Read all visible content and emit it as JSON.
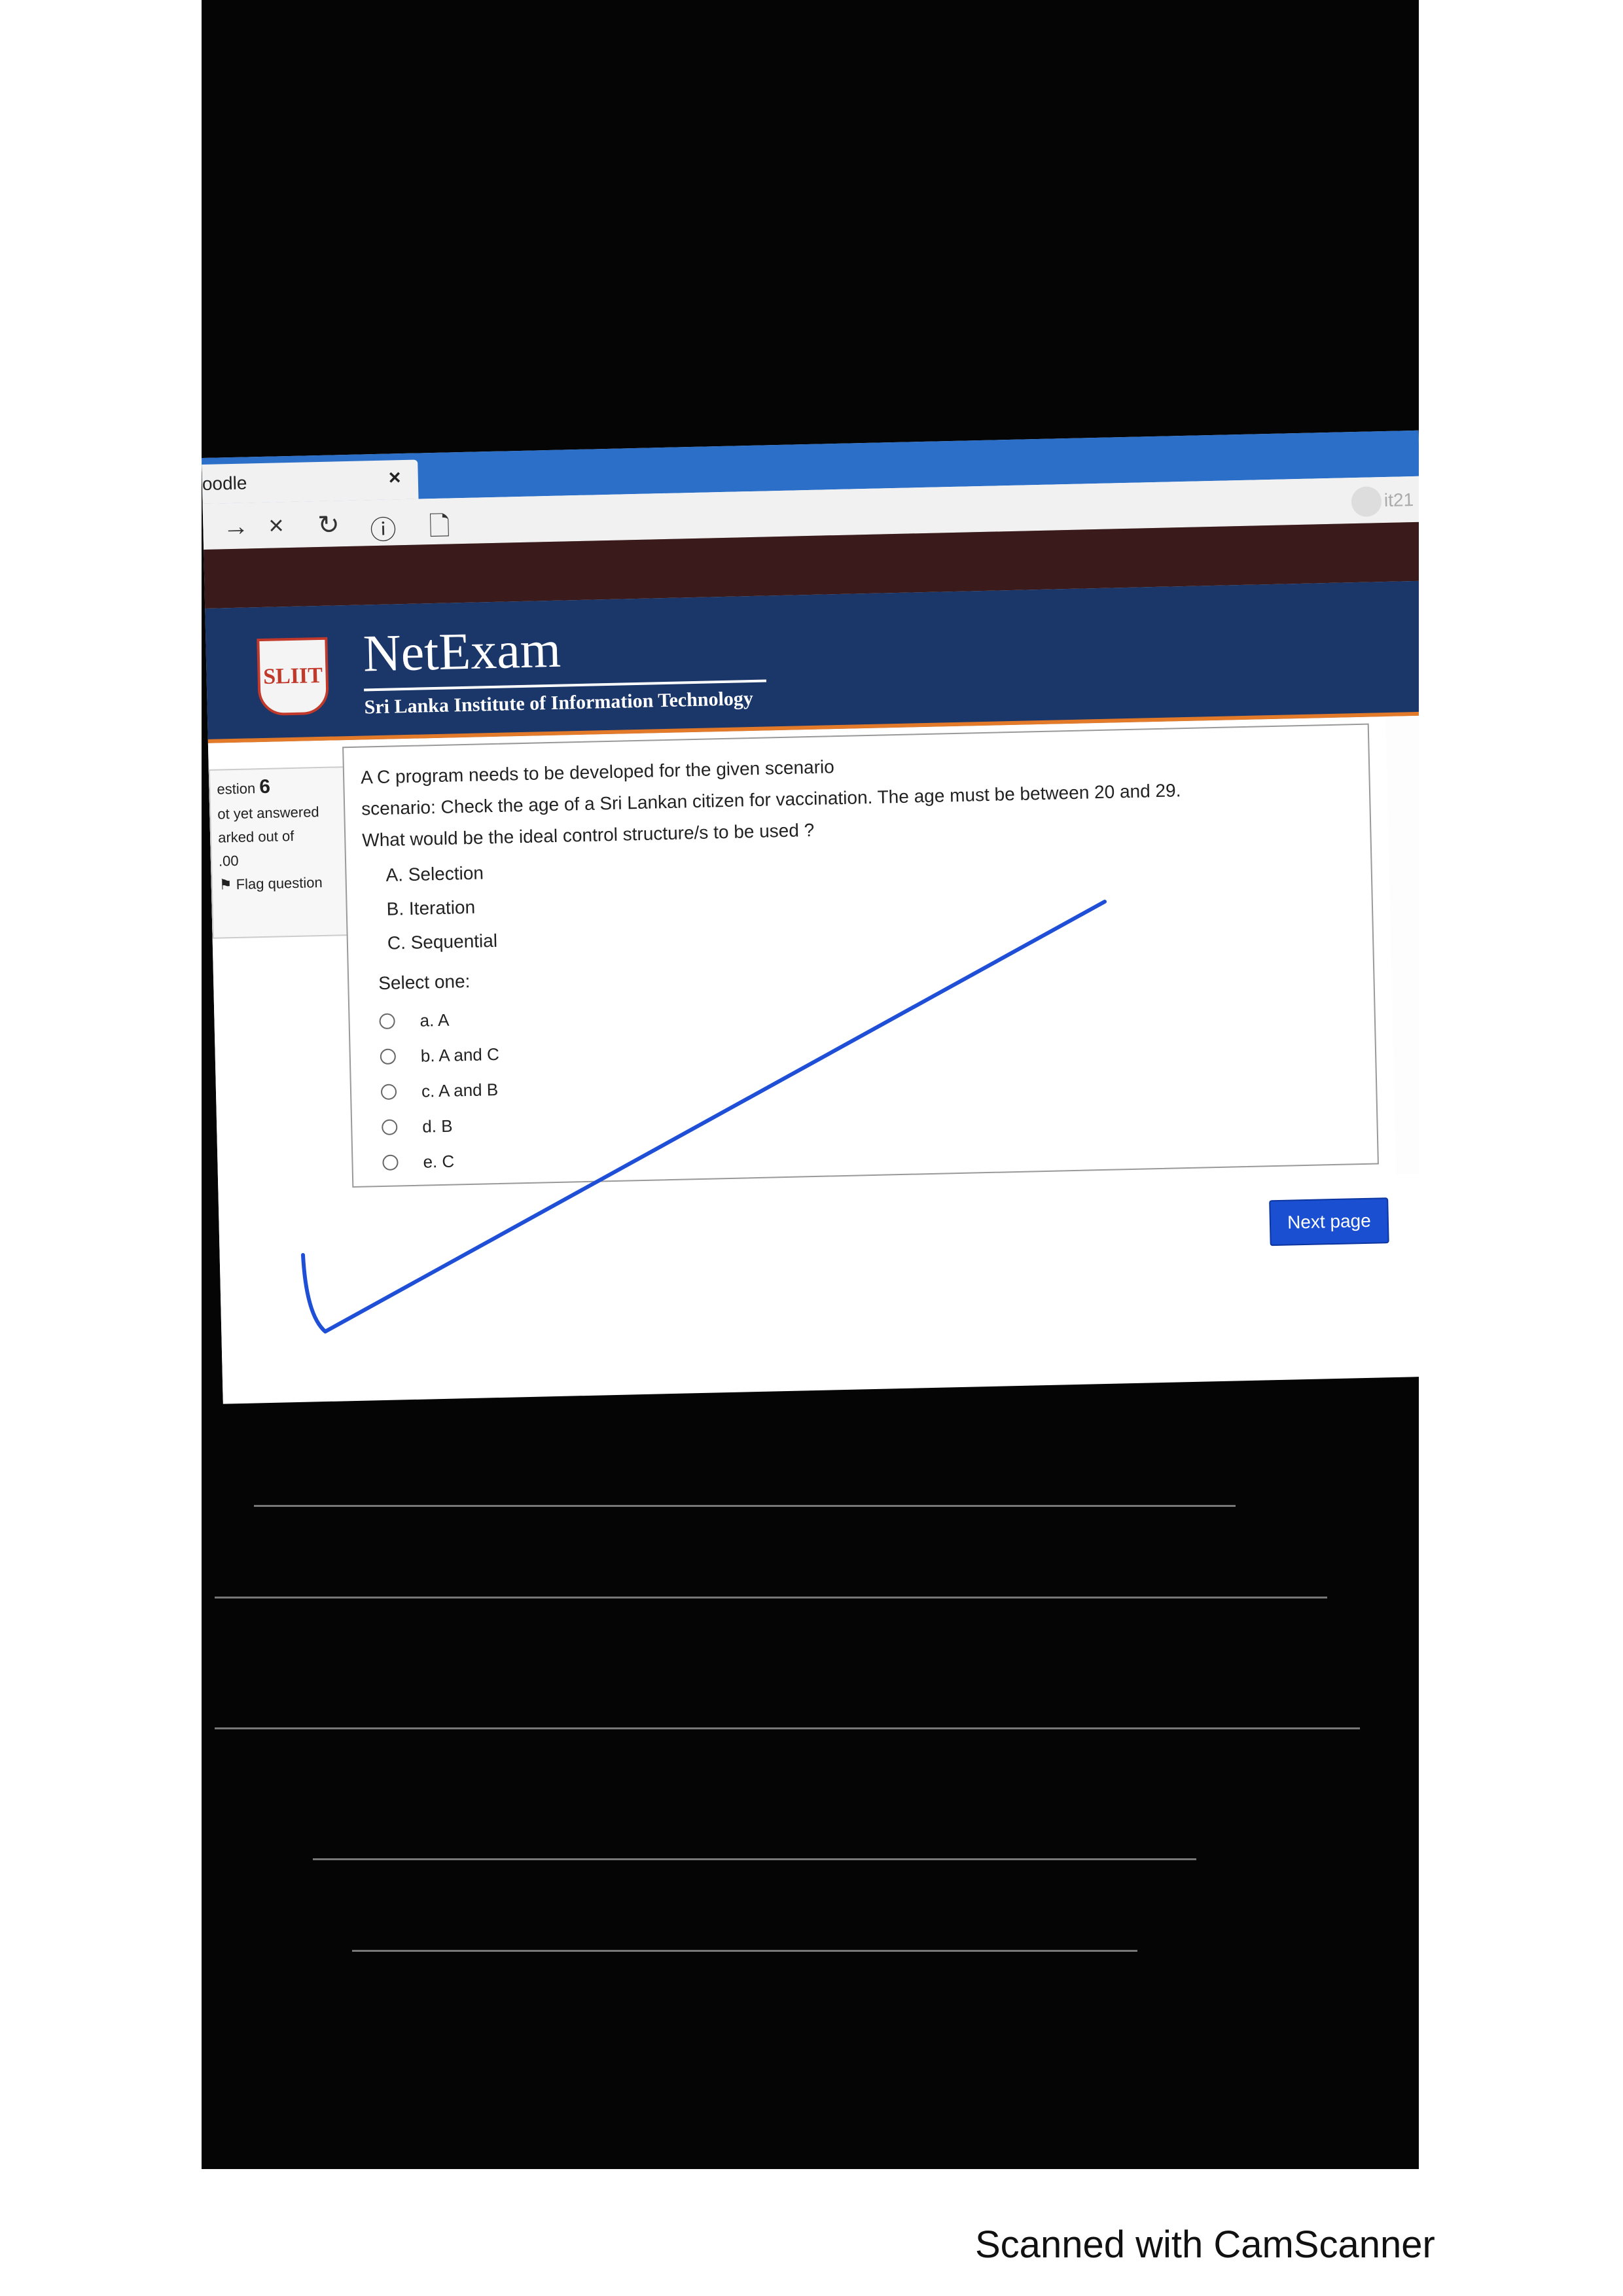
{
  "browser": {
    "tab_title": "oodle",
    "tab_close": "×",
    "nav": {
      "forward": "→",
      "stop": "×",
      "reload": "↻",
      "info": "ⓘ",
      "page": "🗋"
    },
    "profile_text": "it21"
  },
  "header": {
    "logo_text": "SLIIT",
    "brand": "NetExam",
    "subtitle": "Sri Lanka Institute of Information Technology"
  },
  "question_info": {
    "label": "estion",
    "number": "6",
    "status": "ot yet answered",
    "marked": "arked out of",
    "points": ".00",
    "flag": "Flag question"
  },
  "question": {
    "line1": "A C program needs to be developed for the given scenario",
    "line2": "scenario: Check the age of a Sri Lankan citizen for vaccination. The age must be between 20 and 29.",
    "line3": "What would be the ideal control structure/s to be used ?",
    "choices": [
      "A. Selection",
      "B. Iteration",
      "C. Sequential"
    ],
    "select_label": "Select one:",
    "options": [
      "a. A",
      "b. A and C",
      "c. A and B",
      "d. B",
      "e. C"
    ]
  },
  "next_button": "Next page",
  "menu_icon": "hamburger-icon",
  "footer": "Scanned with CamScanner",
  "colors": {
    "header": "#1b3668",
    "accent": "#e27a2a",
    "tabbar": "#2b6fc8",
    "button": "#1a4fd1",
    "check": "#1f4fd6"
  }
}
